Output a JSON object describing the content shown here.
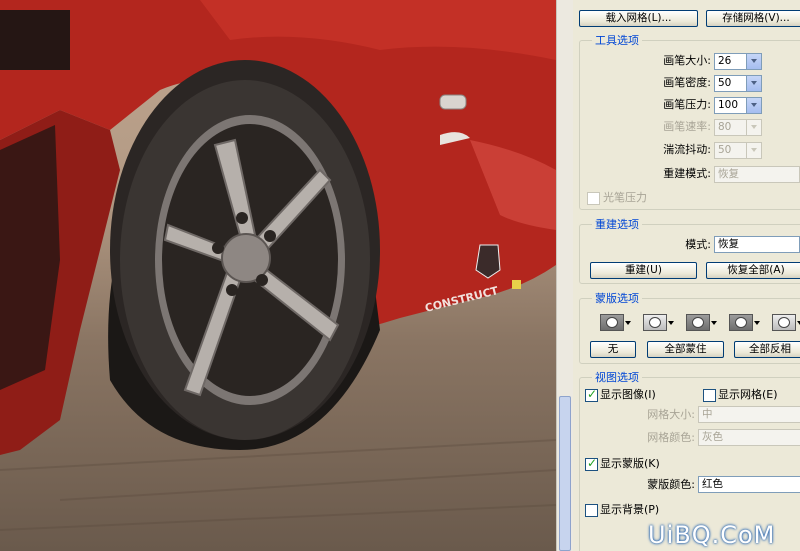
{
  "photo": {
    "badge_text": "CONSTRUCT"
  },
  "buttons": {
    "load_mesh": "载入网格(L)...",
    "save_mesh": "存储网格(V)..."
  },
  "tool_options": {
    "title": "工具选项",
    "brush_size": {
      "label": "画笔大小:",
      "value": "26"
    },
    "brush_density": {
      "label": "画笔密度:",
      "value": "50"
    },
    "brush_pressure": {
      "label": "画笔压力:",
      "value": "100"
    },
    "brush_rate": {
      "label": "画笔速率:",
      "value": "80"
    },
    "turbulent_jitter": {
      "label": "湍流抖动:",
      "value": "50"
    },
    "reconstruct_mode": {
      "label": "重建模式:",
      "value": "恢复"
    },
    "stylus_pressure": "光笔压力"
  },
  "reconstruct_options": {
    "title": "重建选项",
    "mode_label": "模式:",
    "mode_value": "恢复",
    "reconstruct_button": "重建(U)",
    "restore_all_button": "恢复全部(A)"
  },
  "mask_options": {
    "title": "蒙版选项",
    "none_button": "无",
    "mask_all_button": "全部蒙住",
    "invert_all_button": "全部反相"
  },
  "view_options": {
    "title": "视图选项",
    "show_image": {
      "label": "显示图像(I)",
      "checked": true
    },
    "show_mesh": {
      "label": "显示网格(E)",
      "checked": false
    },
    "mesh_size": {
      "label": "网格大小:",
      "value": "中"
    },
    "mesh_color": {
      "label": "网格颜色:",
      "value": "灰色"
    },
    "show_mask": {
      "label": "显示蒙版(K)",
      "checked": true
    },
    "mask_color": {
      "label": "蒙版颜色:",
      "value": "红色"
    },
    "show_backdrop": {
      "label": "显示背景(P)",
      "checked": false
    }
  },
  "watermark": "UiBQ.CoM",
  "colors": {
    "panel_bg": "#ece9d8",
    "group_title": "#0046d5",
    "car_red": "#b3261e"
  }
}
